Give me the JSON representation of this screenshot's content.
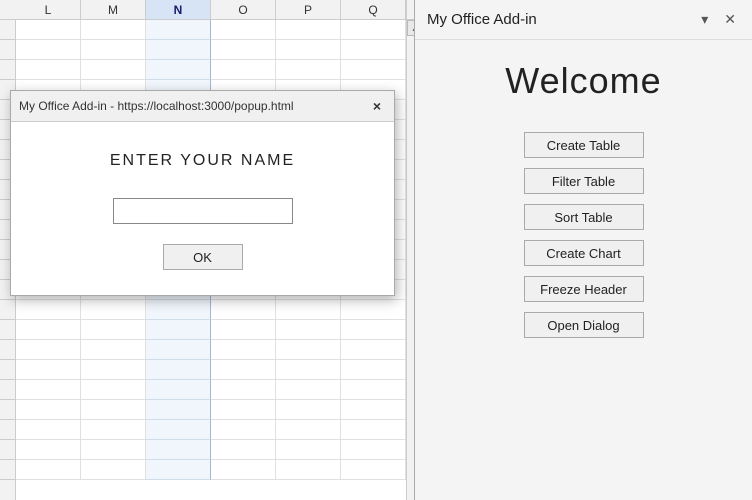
{
  "excel": {
    "columns": [
      "L",
      "M",
      "N",
      "O",
      "P",
      "Q"
    ],
    "rowCount": 23
  },
  "dialog": {
    "title": "My Office Add-in - https://localhost:3000/popup.html",
    "prompt": "ENTER YOUR NAME",
    "input_placeholder": "",
    "ok_label": "OK",
    "close_label": "×"
  },
  "addin": {
    "title": "My Office Add-in",
    "welcome": "Welcome",
    "minimize_icon": "▾",
    "close_icon": "✕",
    "buttons": [
      {
        "label": "Create Table",
        "name": "create-table-button"
      },
      {
        "label": "Filter Table",
        "name": "filter-table-button"
      },
      {
        "label": "Sort Table",
        "name": "sort-table-button"
      },
      {
        "label": "Create Chart",
        "name": "create-chart-button"
      },
      {
        "label": "Freeze Header",
        "name": "freeze-header-button"
      },
      {
        "label": "Open Dialog",
        "name": "open-dialog-button"
      }
    ]
  }
}
